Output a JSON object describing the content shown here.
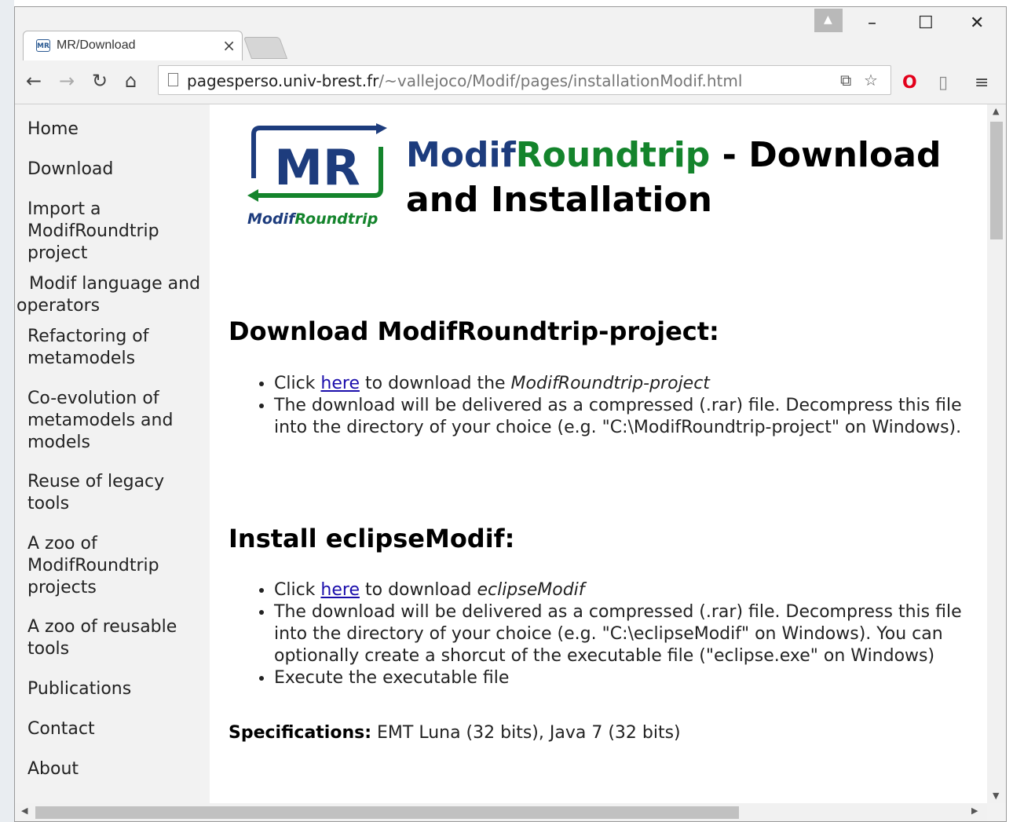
{
  "browser": {
    "tab_title": "MR/Download",
    "tab_close": "×",
    "url_host": "pagesperso.univ-brest.fr",
    "url_path": "/~vallejoco/Modif/pages/installationModif.html",
    "window_controls": {
      "minimize": "–",
      "maximize": "☐",
      "close": "✕"
    }
  },
  "sidebar": {
    "items": [
      {
        "label": "Home"
      },
      {
        "label": "Download"
      },
      {
        "label": "Import a ModifRoundtrip project"
      },
      {
        "label": "Modif language and operators"
      },
      {
        "label": "Refactoring of metamodels"
      },
      {
        "label": "Co-evolution of metamodels and models"
      },
      {
        "label": "Reuse of legacy tools"
      },
      {
        "label": "A zoo of ModifRoundtrip projects"
      },
      {
        "label": "A zoo of reusable tools"
      },
      {
        "label": "Publications"
      },
      {
        "label": "Contact"
      },
      {
        "label": "About"
      }
    ]
  },
  "header": {
    "logo_letters": "MR",
    "logo_caption_1": "Modif",
    "logo_caption_2": "Roundtrip",
    "title_part1": "Modif",
    "title_part2": "Roundtrip",
    "title_part3": " - Download and Installation"
  },
  "section_download": {
    "heading": "Download ModifRoundtrip-project:",
    "item1_pre": "Click ",
    "item1_link": "here",
    "item1_mid": " to download the ",
    "item1_em": "ModifRoundtrip-project",
    "item2": "The download will be delivered as a compressed (.rar) file. Decompress this file into the directory of your choice (e.g. \"C:\\ModifRoundtrip-project\" on Windows)."
  },
  "section_install": {
    "heading": "Install eclipseModif:",
    "item1_pre": "Click ",
    "item1_link": "here",
    "item1_mid": " to download ",
    "item1_em": "eclipseModif",
    "item2": "The download will be delivered as a compressed (.rar) file. Decompress this file into the directory of your choice (e.g. \"C:\\eclipseModif\" on Windows). You can optionally create a shorcut of the executable file (\"eclipse.exe\" on Windows)",
    "item3": "Execute the executable file"
  },
  "specifications": {
    "label": "Specifications:",
    "value": " EMT Luna (32 bits), Java 7 (32 bits)"
  }
}
